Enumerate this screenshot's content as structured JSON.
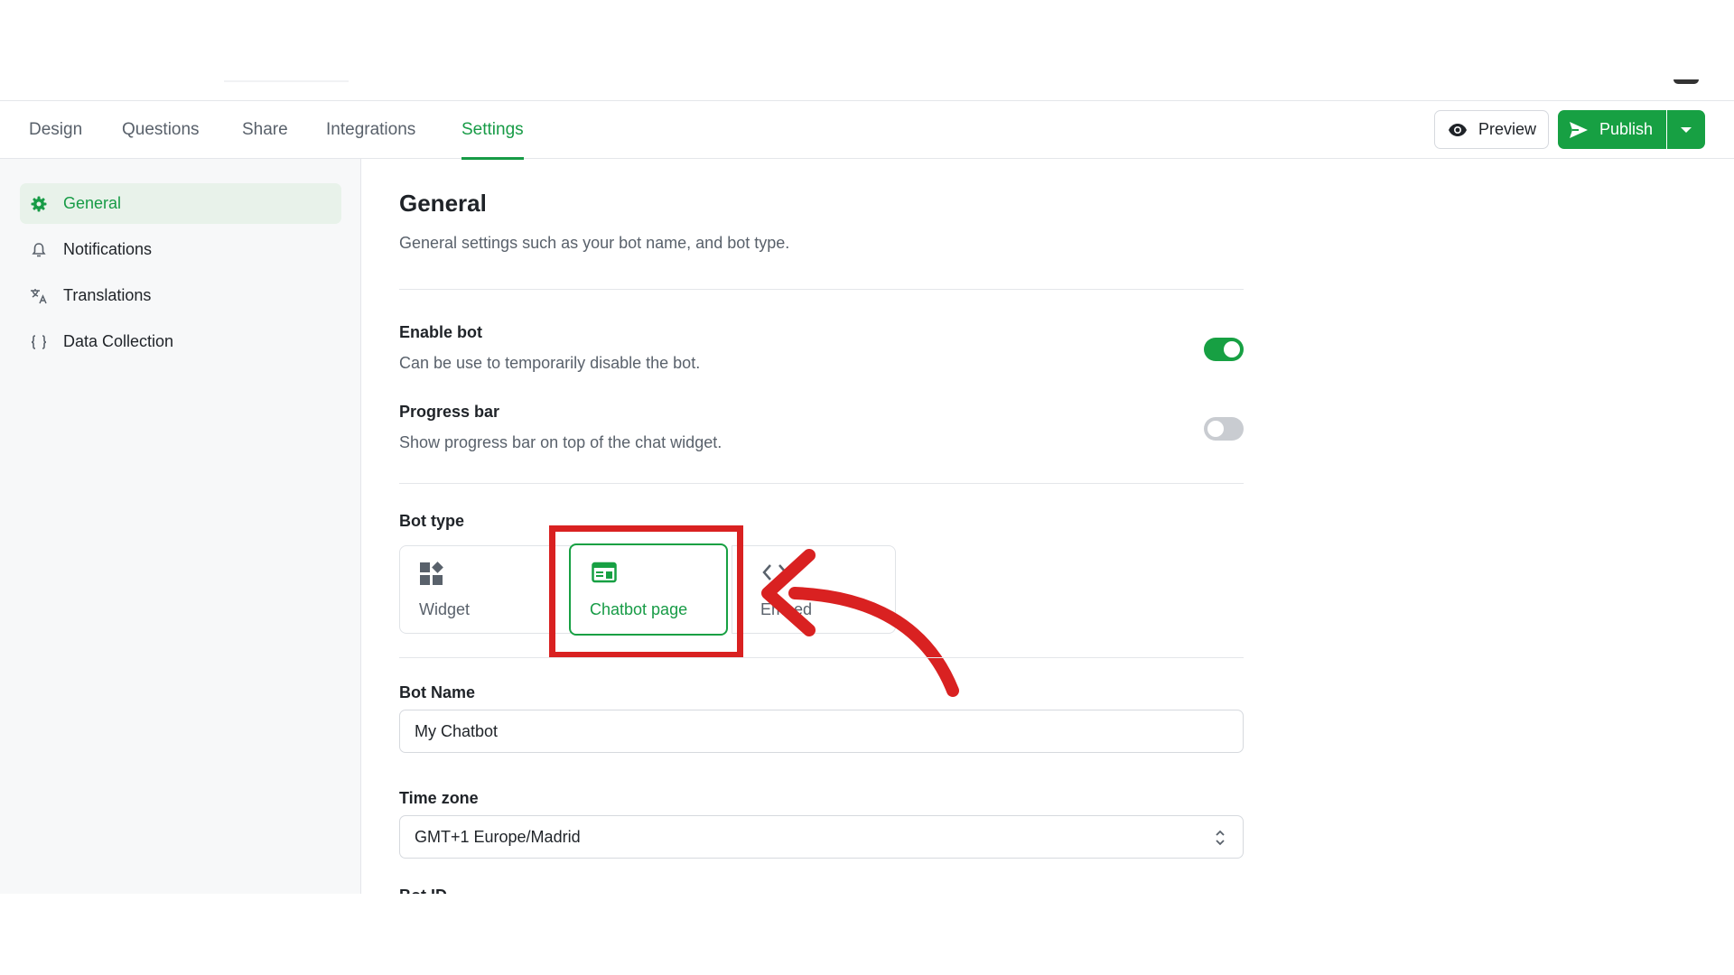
{
  "tabs": [
    {
      "label": "Design"
    },
    {
      "label": "Questions"
    },
    {
      "label": "Share"
    },
    {
      "label": "Integrations"
    },
    {
      "label": "Settings"
    }
  ],
  "actions": {
    "preview_label": "Preview",
    "publish_label": "Publish"
  },
  "sidebar": {
    "items": [
      {
        "label": "General",
        "icon": "gear-icon"
      },
      {
        "label": "Notifications",
        "icon": "bell-icon"
      },
      {
        "label": "Translations",
        "icon": "translate-icon"
      },
      {
        "label": "Data Collection",
        "icon": "braces-icon"
      }
    ]
  },
  "general": {
    "title": "General",
    "subtitle": "General settings such as your bot name, and bot type.",
    "enable_bot": {
      "label": "Enable bot",
      "description": "Can be use to temporarily disable the bot.",
      "enabled": true
    },
    "progress_bar": {
      "label": "Progress bar",
      "description": "Show progress bar on top of the chat widget.",
      "enabled": false
    },
    "bot_type": {
      "label": "Bot type",
      "options": [
        {
          "label": "Widget",
          "icon": "widget-icon"
        },
        {
          "label": "Chatbot page",
          "icon": "page-icon",
          "selected": true
        },
        {
          "label": "Embed",
          "icon": "embed-icon"
        }
      ]
    },
    "bot_name": {
      "label": "Bot Name",
      "value": "My Chatbot"
    },
    "time_zone": {
      "label": "Time zone",
      "value": "GMT+1 Europe/Madrid"
    },
    "bot_id": {
      "label": "Bot ID"
    }
  },
  "colors": {
    "accent": "#17a043",
    "annotation": "#d92121"
  }
}
